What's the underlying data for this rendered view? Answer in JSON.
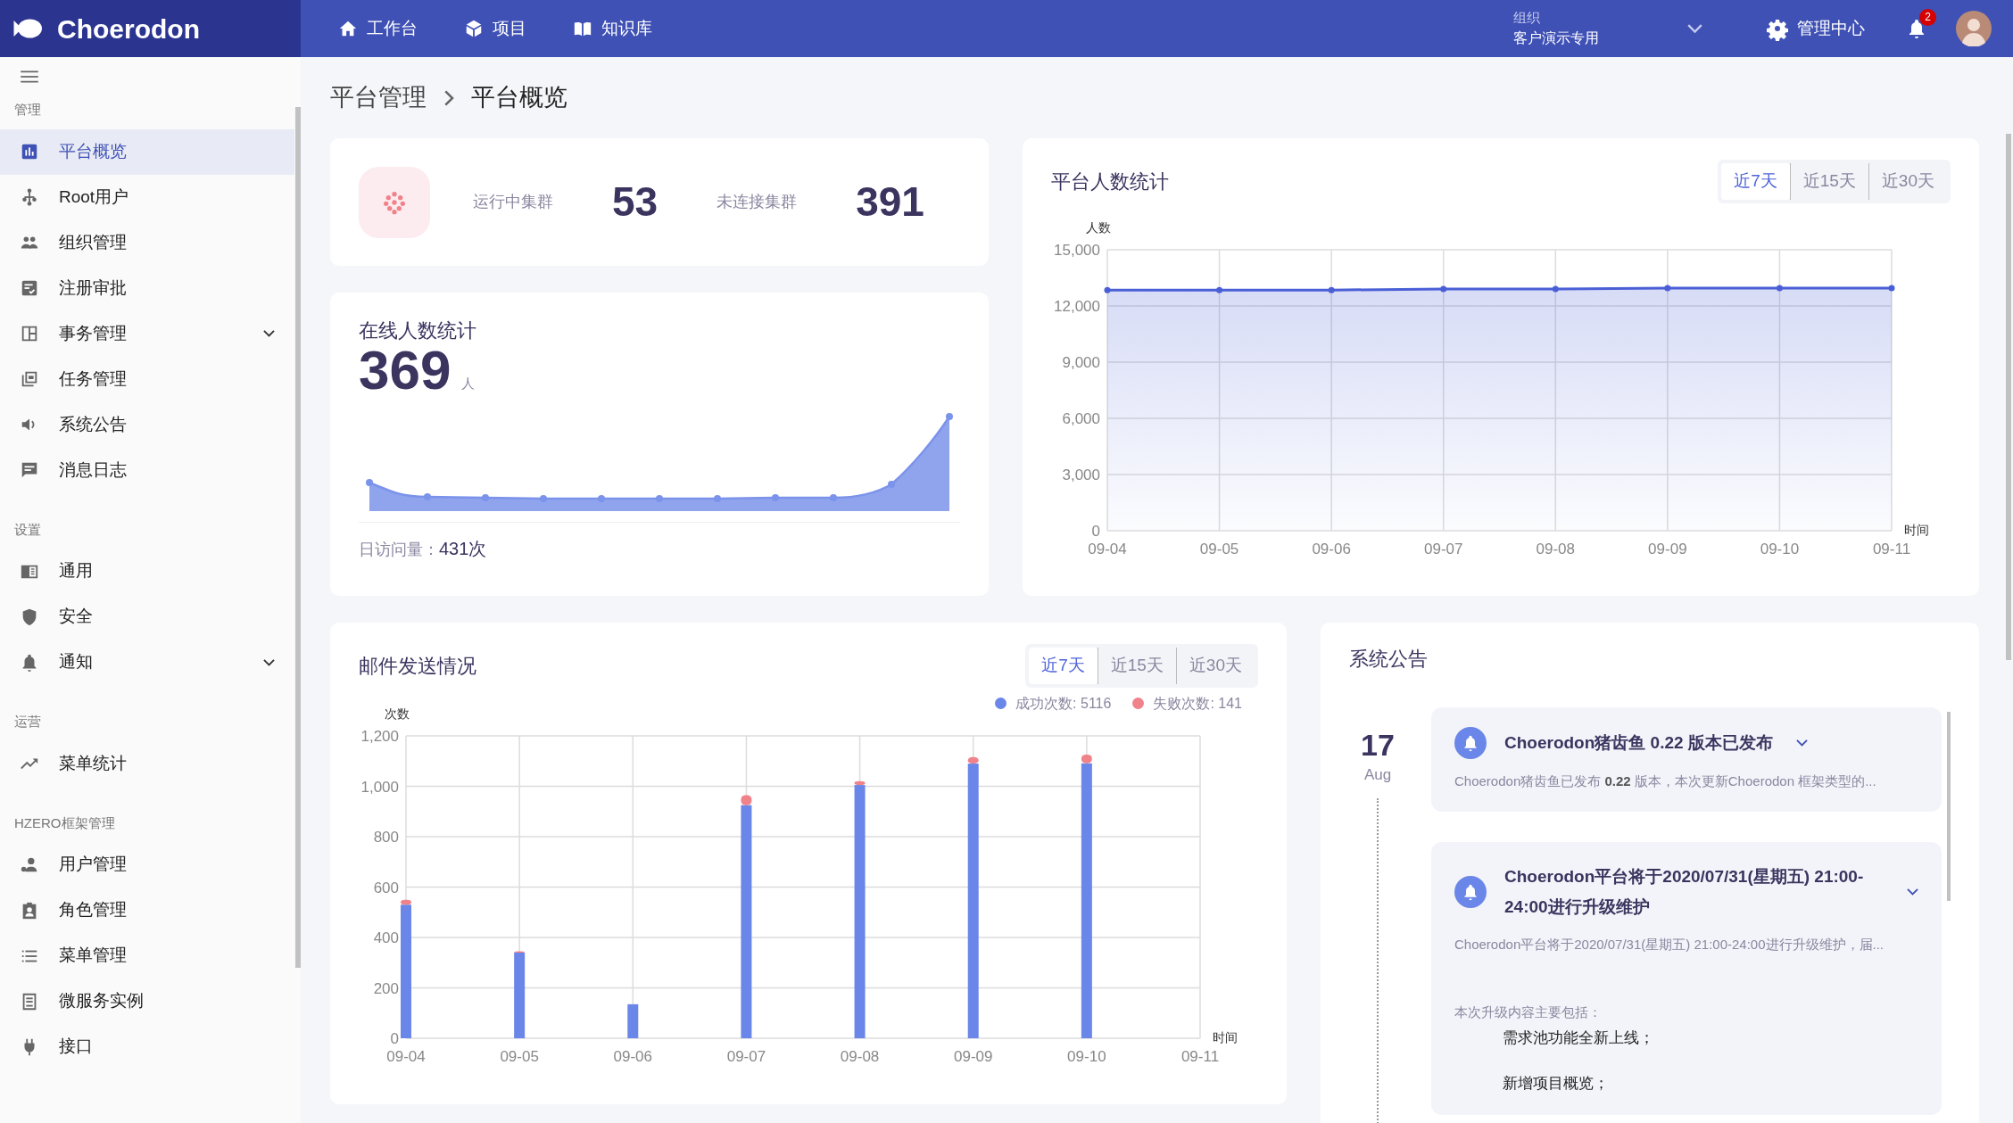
{
  "topbar": {
    "logo": "Choerodon",
    "nav": [
      {
        "label": "工作台"
      },
      {
        "label": "项目"
      },
      {
        "label": "知识库"
      }
    ],
    "org": {
      "label": "组织",
      "value": "客户演示专用"
    },
    "admin": "管理中心",
    "notifications": "2"
  },
  "sidebar": {
    "sections": [
      {
        "title": "管理",
        "items": [
          {
            "label": "平台概览",
            "kind": "link",
            "selected": true
          },
          {
            "label": "Root用户",
            "kind": "link",
            "selected": false
          },
          {
            "label": "组织管理",
            "kind": "link",
            "selected": false
          },
          {
            "label": "注册审批",
            "kind": "link",
            "selected": false
          },
          {
            "label": "事务管理",
            "kind": "group",
            "selected": false
          },
          {
            "label": "任务管理",
            "kind": "link",
            "selected": false
          },
          {
            "label": "系统公告",
            "kind": "link",
            "selected": false
          },
          {
            "label": "消息日志",
            "kind": "link",
            "selected": false
          }
        ]
      },
      {
        "title": "设置",
        "items": [
          {
            "label": "通用",
            "kind": "link",
            "selected": false
          },
          {
            "label": "安全",
            "kind": "link",
            "selected": false
          },
          {
            "label": "通知",
            "kind": "group",
            "selected": false
          }
        ]
      },
      {
        "title": "运营",
        "items": [
          {
            "label": "菜单统计",
            "kind": "link",
            "selected": false
          }
        ]
      },
      {
        "title": "HZERO框架管理",
        "items": [
          {
            "label": "用户管理",
            "kind": "link",
            "selected": false
          },
          {
            "label": "角色管理",
            "kind": "link",
            "selected": false
          },
          {
            "label": "菜单管理",
            "kind": "link",
            "selected": false
          },
          {
            "label": "微服务实例",
            "kind": "link",
            "selected": false
          },
          {
            "label": "接口",
            "kind": "link",
            "selected": false
          }
        ]
      }
    ]
  },
  "breadcrumb": [
    "平台管理",
    "平台概览"
  ],
  "cluster_stats": [
    {
      "label": "运行中集群",
      "value": "53"
    },
    {
      "label": "未连接集群",
      "value": "391"
    }
  ],
  "online_users": {
    "title": "在线人数统计",
    "value": "369",
    "unit": "人",
    "visits_label": "日访问量：",
    "visits_value": "431次"
  },
  "platform_users": {
    "title": "平台人数统计",
    "ranges": [
      {
        "label": "近7天",
        "selected": true
      },
      {
        "label": "近15天",
        "selected": false
      },
      {
        "label": "近30天",
        "selected": false
      }
    ],
    "chart_data": {
      "type": "area",
      "ylabel": "人数",
      "xlabel": "时间",
      "categories": [
        "09-04",
        "09-05",
        "09-06",
        "09-07",
        "09-08",
        "09-09",
        "09-10",
        "09-11"
      ],
      "series": [
        {
          "color": "#4a5fd6",
          "values": [
            12850,
            12850,
            12850,
            12900,
            12900,
            12950,
            12950,
            12950
          ]
        }
      ],
      "grid": true,
      "ylim": [
        0,
        15000
      ],
      "yticks": [
        0,
        {
          "value": 3000,
          "label": "3,000"
        },
        {
          "value": 6000,
          "label": "6,000"
        },
        {
          "value": 9000,
          "label": "9,000"
        },
        {
          "value": 12000,
          "label": "12,000"
        },
        {
          "value": 15000,
          "label": "15,000"
        }
      ]
    }
  },
  "mail_stats": {
    "title": "邮件发送情况",
    "ranges": [
      {
        "label": "近7天",
        "selected": true
      },
      {
        "label": "近15天",
        "selected": false
      },
      {
        "label": "近30天",
        "selected": false
      }
    ],
    "chart_data": {
      "type": "bar",
      "stacked": true,
      "ylabel": "次数",
      "xlabel": "时间",
      "categories": [
        "09-04",
        "09-05",
        "09-06",
        "09-07",
        "09-08",
        "09-09",
        "09-10",
        "09-11"
      ],
      "series": [
        {
          "name": "成功次数: 5116",
          "color": "#6a86e8",
          "values": [
            530,
            340,
            135,
            925,
            1005,
            1090,
            1091,
            null
          ]
        },
        {
          "name": "失败次数: 141",
          "color": "#f08289",
          "values": [
            20,
            5,
            0,
            40,
            15,
            26,
            35,
            null
          ]
        }
      ],
      "grid": true,
      "legend": true,
      "ylim": [
        0,
        1200
      ],
      "yticks": [
        0,
        200,
        400,
        600,
        800,
        {
          "value": 1000,
          "label": "1,000"
        },
        {
          "value": 1200,
          "label": "1,200"
        }
      ]
    }
  },
  "announcements": {
    "title": "系统公告",
    "day": "17",
    "month": "Aug",
    "items": [
      {
        "title": "Choerodon猪齿鱼 0.22 版本已发布",
        "summary": "Choerodon猪齿鱼已发布 **0.22** 版本，本次更新Choerodon 框架类型的..."
      },
      {
        "title": "Choerodon平台将于2020/07/31(星期五) 21:00-24:00进行升级维护",
        "summary": "Choerodon平台将于2020/07/31(星期五) 21:00-24:00进行升级维护，届...",
        "intro": "本次升级内容主要包括：",
        "points": [
          "需求池功能全新上线；",
          "新增项目概览；"
        ]
      }
    ]
  }
}
